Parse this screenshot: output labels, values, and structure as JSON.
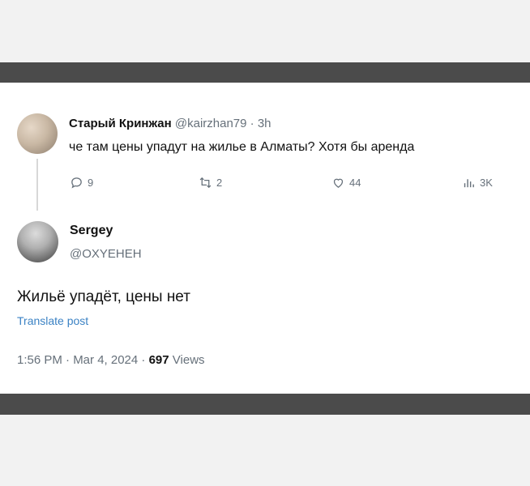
{
  "tweet1": {
    "display_name": "Старый Кринжан",
    "handle": "@kairzhan79",
    "separator": "·",
    "time": "3h",
    "text": "че там цены упадут на жилье в Алматы? Хотя бы аренда",
    "actions": {
      "replies": "9",
      "reposts": "2",
      "likes": "44",
      "views": "3K"
    }
  },
  "tweet2": {
    "display_name": "Sergey",
    "handle": "@OXYEHEH",
    "text": "Жильё упадёт, цены нет",
    "translate_label": "Translate post",
    "timestamp": "1:56 PM · Mar 4, 2024 ·",
    "views_count": "697",
    "views_label": "Views"
  },
  "icons": {
    "reply": "reply-icon",
    "repost": "repost-icon",
    "like": "heart-icon",
    "views": "views-chart-icon"
  }
}
